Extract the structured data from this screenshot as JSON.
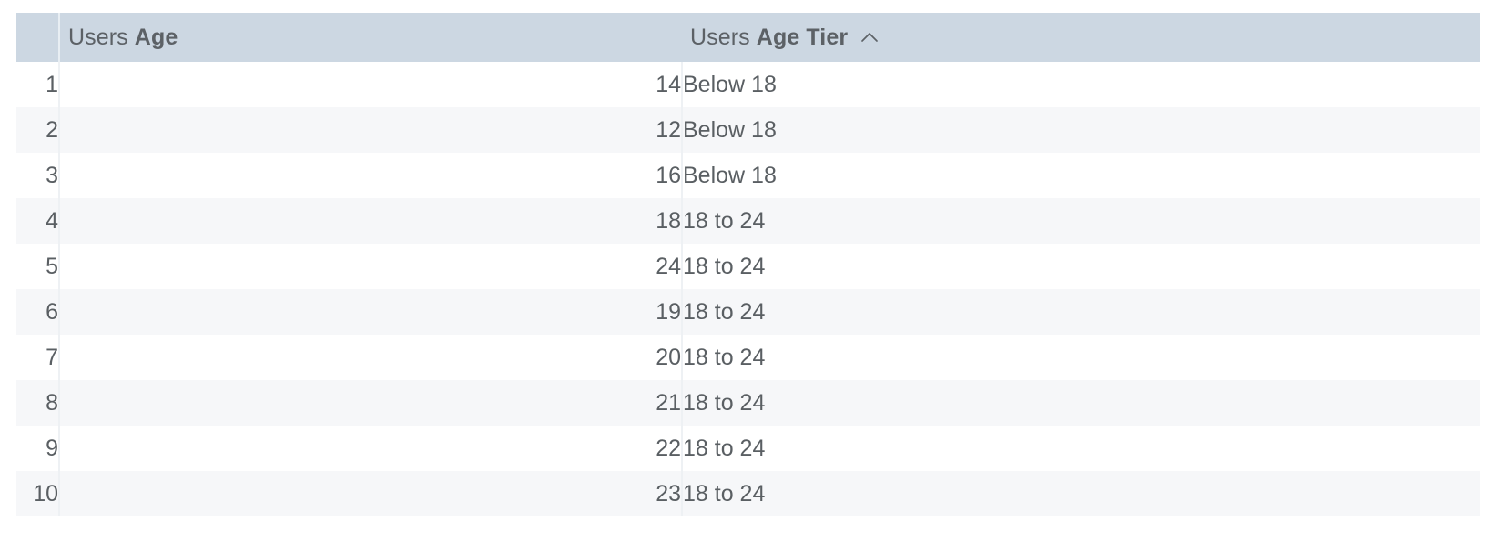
{
  "table": {
    "columns": [
      {
        "id": "row-number",
        "label": "",
        "prefix": "",
        "field": "",
        "align": "right",
        "sorted": false
      },
      {
        "id": "users-age",
        "label": "Users Age",
        "prefix": "Users",
        "field": "Age",
        "align": "right",
        "sorted": false,
        "sort_icon": ""
      },
      {
        "id": "users-age-tier",
        "label": "Users Age Tier",
        "prefix": "Users",
        "field": "Age Tier",
        "align": "left",
        "sorted": true,
        "sort_direction": "ascending",
        "sort_icon": "chevron-up-icon"
      }
    ],
    "rows": [
      {
        "num": "1",
        "age": "14",
        "tier": "Below 18"
      },
      {
        "num": "2",
        "age": "12",
        "tier": "Below 18"
      },
      {
        "num": "3",
        "age": "16",
        "tier": "Below 18"
      },
      {
        "num": "4",
        "age": "18",
        "tier": "18 to 24"
      },
      {
        "num": "5",
        "age": "24",
        "tier": "18 to 24"
      },
      {
        "num": "6",
        "age": "19",
        "tier": "18 to 24"
      },
      {
        "num": "7",
        "age": "20",
        "tier": "18 to 24"
      },
      {
        "num": "8",
        "age": "21",
        "tier": "18 to 24"
      },
      {
        "num": "9",
        "age": "22",
        "tier": "18 to 24"
      },
      {
        "num": "10",
        "age": "23",
        "tier": "18 to 24"
      }
    ]
  },
  "colors": {
    "header_background": "#ccd7e2",
    "header_text": "#5c6166",
    "row_odd_background": "#ffffff",
    "row_even_background": "#f6f7f9",
    "cell_text": "#5a5f63",
    "row_number_text": "#bcc1c6",
    "divider": "#eef1f4"
  }
}
